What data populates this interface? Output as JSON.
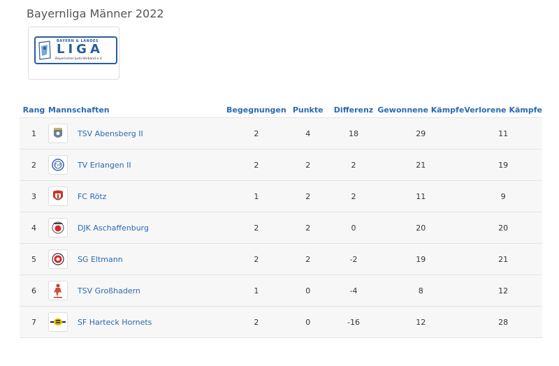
{
  "page": {
    "title": "Bayernliga Männer 2022"
  },
  "league_logo": {
    "top_text": "BAYERN & LANDES",
    "main_text": "LIGA",
    "sub_text": "Bayerischer Judo-Verband e.V."
  },
  "table": {
    "headers": {
      "rank": "Rang",
      "team": "Mannschaften",
      "matches": "Begegnungen",
      "points": "Punkte",
      "diff": "Differenz",
      "won": "Gewonnene Kämpfe",
      "lost": "Verlorene Kämpfe"
    },
    "rows": [
      {
        "rank": "1",
        "team": "TSV Abensberg II",
        "matches": "2",
        "points": "4",
        "diff": "18",
        "won": "29",
        "lost": "11",
        "logo_icon": "abensberg-crest-icon"
      },
      {
        "rank": "2",
        "team": "TV Erlangen II",
        "matches": "2",
        "points": "2",
        "diff": "2",
        "won": "21",
        "lost": "19",
        "logo_icon": "erlangen-badge-icon"
      },
      {
        "rank": "3",
        "team": "FC Rötz",
        "matches": "1",
        "points": "2",
        "diff": "2",
        "won": "11",
        "lost": "9",
        "logo_icon": "roetz-shield-icon"
      },
      {
        "rank": "4",
        "team": "DJK Aschaffenburg",
        "matches": "2",
        "points": "2",
        "diff": "0",
        "won": "20",
        "lost": "20",
        "logo_icon": "aschaffenburg-emblem-icon"
      },
      {
        "rank": "5",
        "team": "SG Eltmann",
        "matches": "2",
        "points": "2",
        "diff": "-2",
        "won": "19",
        "lost": "21",
        "logo_icon": "eltmann-roundel-icon"
      },
      {
        "rank": "6",
        "team": "TSV Großhadern",
        "matches": "1",
        "points": "0",
        "diff": "-4",
        "won": "8",
        "lost": "12",
        "logo_icon": "grosshadern-judoka-icon"
      },
      {
        "rank": "7",
        "team": "SF Harteck Hornets",
        "matches": "2",
        "points": "0",
        "diff": "-16",
        "won": "12",
        "lost": "28",
        "logo_icon": "hornets-wordmark-icon"
      }
    ]
  },
  "colors": {
    "accent": "#2a6ab0",
    "row_bg": "#f7f7f7",
    "text": "#333333"
  }
}
